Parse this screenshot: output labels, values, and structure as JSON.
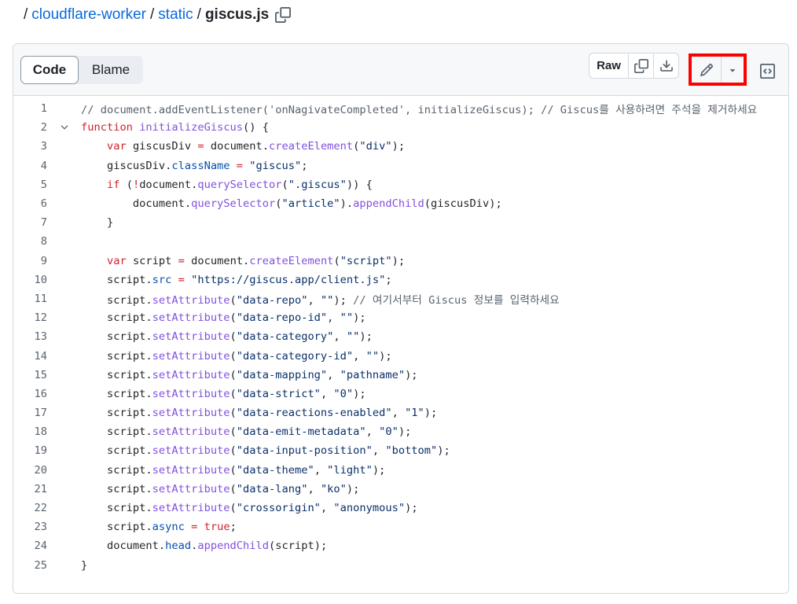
{
  "breadcrumb": {
    "separator": "/",
    "repo": "cloudflare-worker",
    "folder": "static",
    "file": "giscus.js",
    "copy_icon": "copy-icon"
  },
  "toolbar": {
    "tab_code": "Code",
    "tab_blame": "Blame",
    "raw_label": "Raw",
    "icons": [
      "copy-icon",
      "download-icon",
      "pencil-icon",
      "triangle-down-icon",
      "code-square-icon"
    ],
    "highlight_color": "#ff0000"
  },
  "colors": {
    "link": "#0969da",
    "keyword": "#cf222e",
    "function": "#8250df",
    "string": "#0a3069",
    "property": "#0550ae",
    "comment": "#59636e"
  },
  "code": {
    "lines": [
      "// document.addEventListener('onNagivateCompleted', initializeGiscus); // Giscus를 사용하려면 주석을 제거하세요",
      "function initializeGiscus() {",
      "    var giscusDiv = document.createElement(\"div\");",
      "    giscusDiv.className = \"giscus\";",
      "    if (!document.querySelector(\".giscus\")) {",
      "        document.querySelector(\"article\").appendChild(giscusDiv);",
      "    }",
      "",
      "    var script = document.createElement(\"script\");",
      "    script.src = \"https://giscus.app/client.js\";",
      "    script.setAttribute(\"data-repo\", \"\"); // 여기서부터 Giscus 정보를 입력하세요",
      "    script.setAttribute(\"data-repo-id\", \"\");",
      "    script.setAttribute(\"data-category\", \"\");",
      "    script.setAttribute(\"data-category-id\", \"\");",
      "    script.setAttribute(\"data-mapping\", \"pathname\");",
      "    script.setAttribute(\"data-strict\", \"0\");",
      "    script.setAttribute(\"data-reactions-enabled\", \"1\");",
      "    script.setAttribute(\"data-emit-metadata\", \"0\");",
      "    script.setAttribute(\"data-input-position\", \"bottom\");",
      "    script.setAttribute(\"data-theme\", \"light\");",
      "    script.setAttribute(\"data-lang\", \"ko\");",
      "    script.setAttribute(\"crossorigin\", \"anonymous\");",
      "    script.async = true;",
      "    document.head.appendChild(script);",
      "}"
    ]
  }
}
